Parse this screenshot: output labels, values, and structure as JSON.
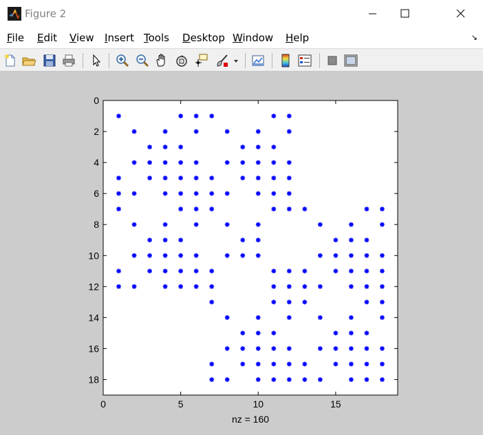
{
  "window": {
    "title": "Figure 2"
  },
  "menu": {
    "items": [
      "File",
      "Edit",
      "View",
      "Insert",
      "Tools",
      "Desktop",
      "Window",
      "Help"
    ],
    "underline": [
      "F",
      "E",
      "V",
      "I",
      "T",
      "D",
      "W",
      "H"
    ]
  },
  "toolbar": {
    "icons": [
      "new-figure-icon",
      "open-file-icon",
      "save-icon",
      "print-icon",
      "pointer-icon",
      "zoom-in-icon",
      "zoom-out-icon",
      "pan-icon",
      "rotate-3d-icon",
      "data-cursor-icon",
      "brush-icon",
      "brush-dropdown-icon",
      "link-plot-icon",
      "colorbar-icon",
      "legend-icon",
      "hide-plot-tools-icon",
      "show-plot-tools-icon"
    ]
  },
  "colors": {
    "marker": "#0000ff",
    "figure_bg": "#cccccc",
    "axes_bg": "#ffffff"
  },
  "chart_data": {
    "type": "scatter",
    "marker": "*",
    "xlabel": "nz = 160",
    "xlim": [
      0,
      19
    ],
    "ylim": [
      0,
      19
    ],
    "y_reversed": true,
    "xticks": [
      0,
      5,
      10,
      15
    ],
    "yticks": [
      0,
      2,
      4,
      6,
      8,
      10,
      12,
      14,
      16,
      18
    ],
    "grid": false,
    "rows": {
      "1": [
        1,
        5,
        6,
        7,
        11,
        12
      ],
      "2": [
        2,
        4,
        6,
        8,
        10,
        12
      ],
      "3": [
        3,
        4,
        5,
        9,
        10,
        11
      ],
      "4": [
        2,
        3,
        4,
        5,
        6,
        8,
        9,
        10,
        11,
        12
      ],
      "5": [
        1,
        3,
        4,
        5,
        6,
        7,
        9,
        10,
        11,
        12
      ],
      "6": [
        1,
        2,
        4,
        5,
        6,
        7,
        8,
        10,
        11,
        12
      ],
      "7": [
        1,
        5,
        6,
        7,
        11,
        12,
        13,
        17,
        18
      ],
      "8": [
        2,
        4,
        6,
        8,
        10,
        14,
        16,
        18
      ],
      "9": [
        3,
        4,
        5,
        9,
        10,
        15,
        16,
        17
      ],
      "10": [
        2,
        3,
        4,
        5,
        6,
        8,
        9,
        10,
        14,
        15,
        16,
        17,
        18
      ],
      "11": [
        1,
        3,
        4,
        5,
        6,
        7,
        11,
        12,
        13,
        15,
        16,
        17,
        18
      ],
      "12": [
        1,
        2,
        4,
        5,
        6,
        7,
        11,
        12,
        13,
        14,
        16,
        17,
        18
      ],
      "13": [
        7,
        11,
        12,
        13,
        17,
        18
      ],
      "14": [
        8,
        10,
        12,
        14,
        16,
        18
      ],
      "15": [
        9,
        10,
        11,
        15,
        16,
        17
      ],
      "16": [
        8,
        9,
        10,
        11,
        12,
        14,
        15,
        16,
        17,
        18
      ],
      "17": [
        7,
        9,
        10,
        11,
        12,
        13,
        15,
        16,
        17,
        18
      ],
      "18": [
        7,
        8,
        10,
        11,
        12,
        13,
        14,
        16,
        17,
        18
      ]
    }
  }
}
